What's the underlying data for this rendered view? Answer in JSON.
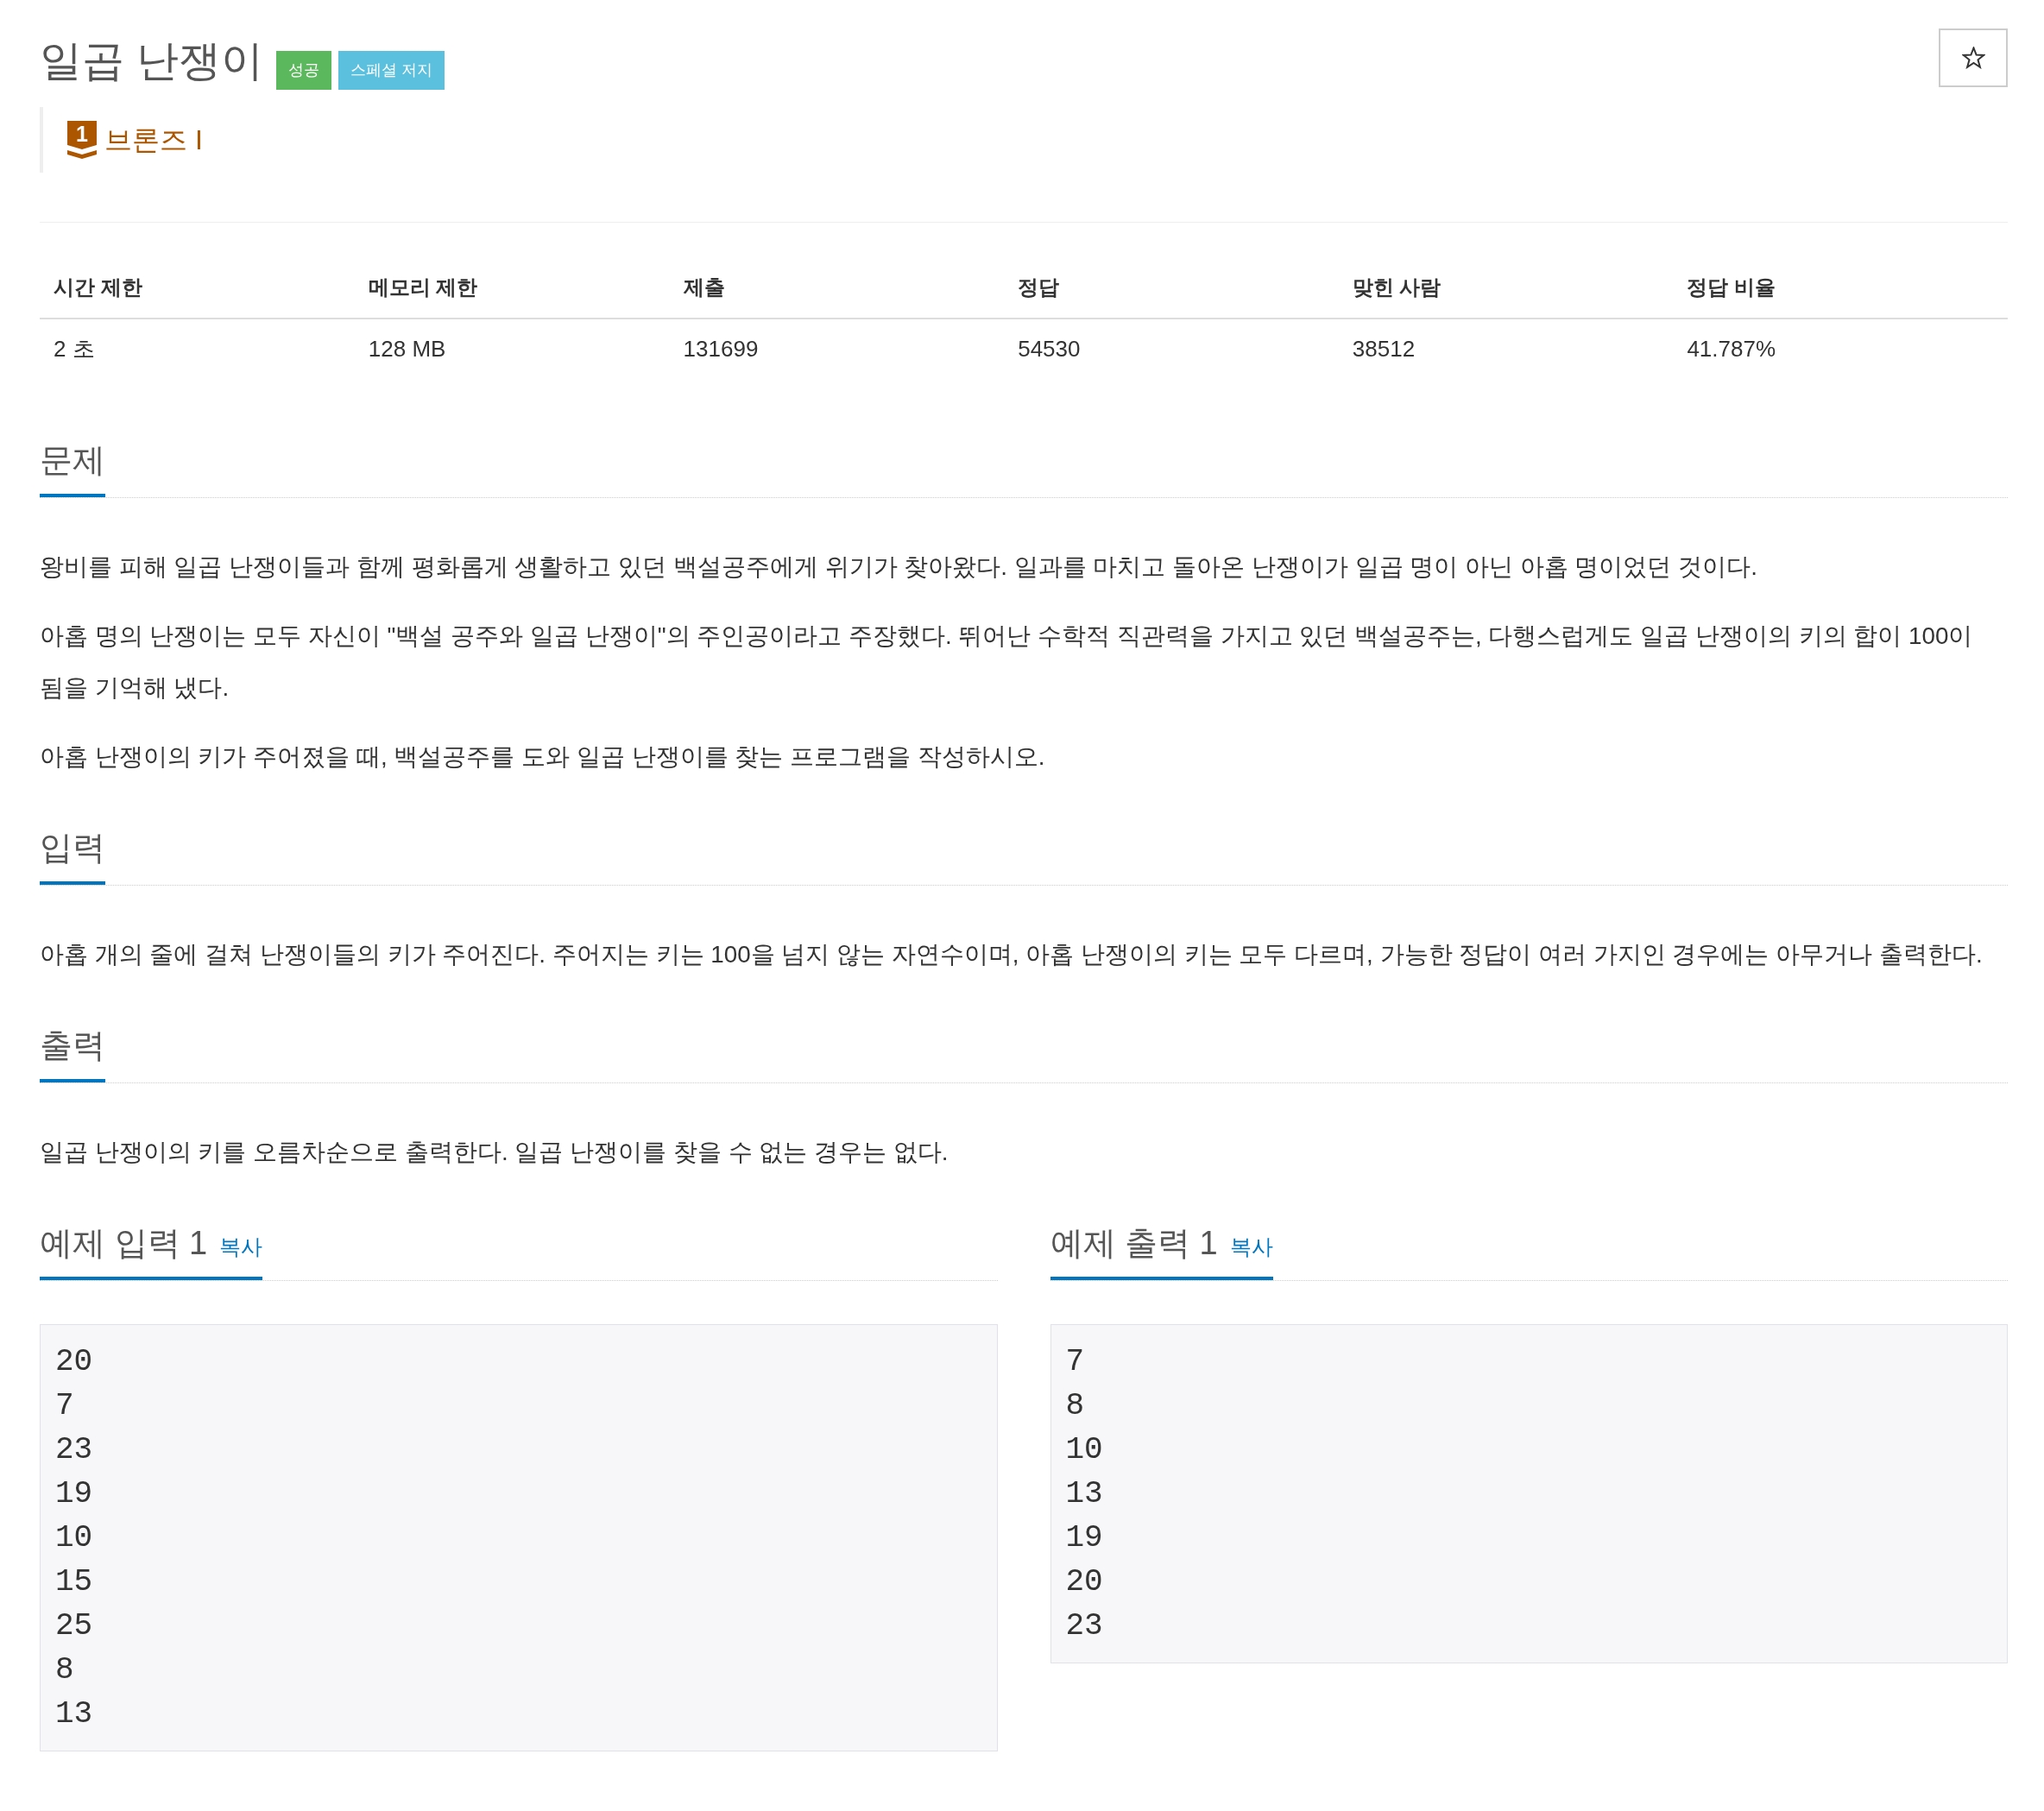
{
  "problem": {
    "title": "일곱 난쟁이",
    "badges": [
      {
        "label": "성공",
        "kind": "success"
      },
      {
        "label": "스페셜 저지",
        "kind": "info"
      }
    ],
    "favorite": false,
    "tier": {
      "kind": "bronze",
      "rank": "1",
      "name": "브론즈 I"
    }
  },
  "stats": {
    "columns": [
      "시간 제한",
      "메모리 제한",
      "제출",
      "정답",
      "맞힌 사람",
      "정답 비율"
    ],
    "values": [
      "2 초",
      "128 MB",
      "131699",
      "54530",
      "38512",
      "41.787%"
    ]
  },
  "sections": [
    {
      "heading": "문제",
      "paragraphs": [
        "왕비를 피해 일곱 난쟁이들과 함께 평화롭게 생활하고 있던 백설공주에게 위기가 찾아왔다. 일과를 마치고 돌아온 난쟁이가 일곱 명이 아닌 아홉 명이었던 것이다.",
        "아홉 명의 난쟁이는 모두 자신이 \"백설 공주와 일곱 난쟁이\"의 주인공이라고 주장했다. 뛰어난 수학적 직관력을 가지고 있던 백설공주는, 다행스럽게도 일곱 난쟁이의 키의 합이 100이 됨을 기억해 냈다.",
        "아홉 난쟁이의 키가 주어졌을 때, 백설공주를 도와 일곱 난쟁이를 찾는 프로그램을 작성하시오."
      ]
    },
    {
      "heading": "입력",
      "paragraphs": [
        "아홉 개의 줄에 걸쳐 난쟁이들의 키가 주어진다. 주어지는 키는 100을 넘지 않는 자연수이며, 아홉 난쟁이의 키는 모두 다르며, 가능한 정답이 여러 가지인 경우에는 아무거나 출력한다."
      ]
    },
    {
      "heading": "출력",
      "paragraphs": [
        "일곱 난쟁이의 키를 오름차순으로 출력한다. 일곱 난쟁이를 찾을 수 없는 경우는 없다."
      ]
    }
  ],
  "samples": [
    {
      "heading": "예제 입력 1",
      "copy": "복사",
      "lines": [
        "20",
        "7",
        "23",
        "19",
        "10",
        "15",
        "25",
        "8",
        "13"
      ]
    },
    {
      "heading": "예제 출력 1",
      "copy": "복사",
      "lines": [
        "7",
        "8",
        "10",
        "13",
        "19",
        "20",
        "23"
      ]
    }
  ]
}
